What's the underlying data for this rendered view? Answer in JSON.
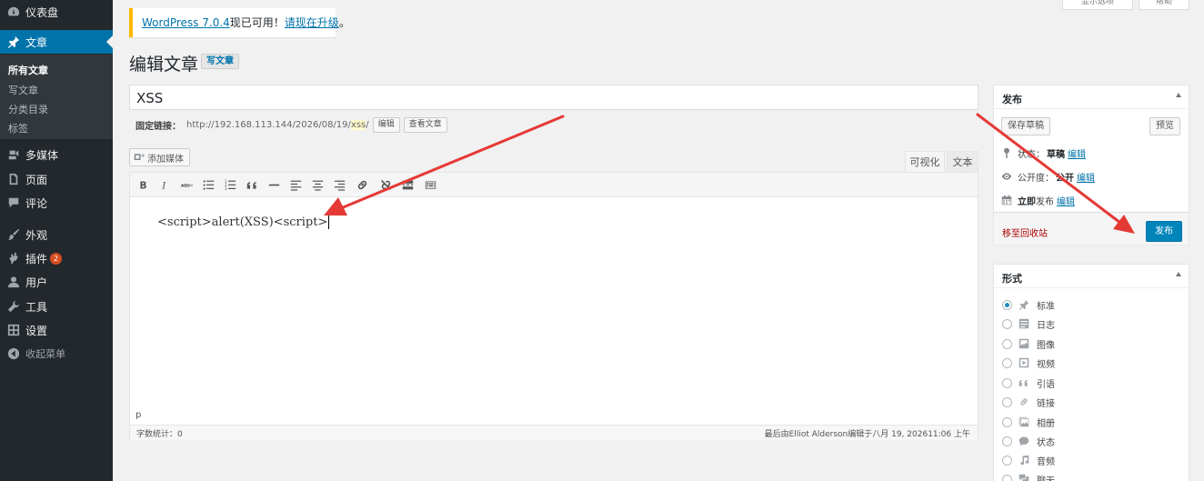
{
  "sidebar": {
    "dashboard": "仪表盘",
    "posts": "文章",
    "posts_sub": [
      "所有文章",
      "写文章",
      "分类目录",
      "标签"
    ],
    "media": "多媒体",
    "pages": "页面",
    "comments": "评论",
    "appearance": "外观",
    "plugins": "插件",
    "plugins_badge": "2",
    "users": "用户",
    "tools": "工具",
    "settings": "设置",
    "collapse": "收起菜单"
  },
  "screen_tabs": {
    "screen_options": "显示选项",
    "help": "帮助"
  },
  "notice": {
    "version_link": "WordPress 7.0.4",
    "middle": "现已可用！",
    "update_link": "请现在升级",
    "end": "。"
  },
  "header": {
    "title": "编辑文章",
    "add_new": "写文章"
  },
  "post": {
    "title": "XSS",
    "permalink_label": "固定链接：",
    "permalink_base": "http://192.168.113.144/2026/08/19/",
    "permalink_slug": "xss",
    "permalink_end": "/",
    "edit_button": "编辑",
    "view_button": "查看文章"
  },
  "editor": {
    "add_media": "添加媒体",
    "tab_visual": "可视化",
    "tab_text": "文本",
    "content": "<script>alert(XSS)<script>",
    "path": "p",
    "word_count": "字数统计：0",
    "last_edited": "最后由Elliot Alderson编辑于八月 19, 202611:06 上午"
  },
  "publish": {
    "title": "发布",
    "save_draft": "保存草稿",
    "preview": "预览",
    "status_label": "状态：",
    "status_value": "草稿",
    "visibility_label": "公开度：",
    "visibility_value": "公开",
    "schedule_label": "立即",
    "schedule_rest": "发布",
    "edit_link": "编辑",
    "trash": "移至回收站",
    "publish_button": "发布"
  },
  "format": {
    "title": "形式",
    "options": [
      "标准",
      "日志",
      "图像",
      "视频",
      "引语",
      "链接",
      "相册",
      "状态",
      "音频",
      "聊天"
    ],
    "selected": "标准"
  },
  "colors": {
    "sidebar_bg": "#23282d",
    "accent": "#0073aa",
    "annotation_arrow": "#e53935"
  }
}
